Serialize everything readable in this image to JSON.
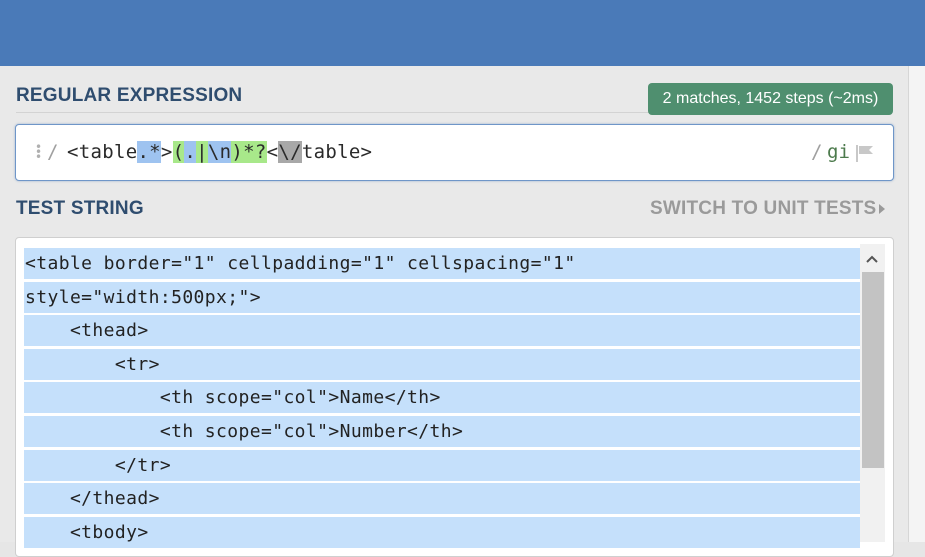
{
  "regex_section": {
    "label": "REGULAR EXPRESSION",
    "match_info": "2 matches, 1452 steps (~2ms)",
    "delimiter_open": "/",
    "delimiter_close": "/",
    "flags": "gi",
    "pattern_parts": [
      {
        "text": "<table",
        "highlight": "none"
      },
      {
        "text": ".*",
        "highlight": "blue"
      },
      {
        "text": ">",
        "highlight": "none"
      },
      {
        "text": "(",
        "highlight": "green"
      },
      {
        "text": ".",
        "highlight": "blue"
      },
      {
        "text": "|",
        "highlight": "green"
      },
      {
        "text": "\\n",
        "highlight": "blue"
      },
      {
        "text": ")*?",
        "highlight": "green"
      },
      {
        "text": "<",
        "highlight": "none"
      },
      {
        "text": "\\/",
        "highlight": "gray"
      },
      {
        "text": "table>",
        "highlight": "none"
      }
    ]
  },
  "test_section": {
    "label": "TEST STRING",
    "switch_label": "SWITCH TO UNIT TESTS",
    "lines": [
      "<table border=\"1\" cellpadding=\"1\" cellspacing=\"1\"",
      "style=\"width:500px;\">",
      "    <thead>",
      "        <tr>",
      "            <th scope=\"col\">Name</th>",
      "            <th scope=\"col\">Number</th>",
      "        </tr>",
      "    </thead>",
      "    <tbody>"
    ]
  },
  "colors": {
    "header": "#4a7ab8",
    "match_badge": "#4f8f6f",
    "match_highlight": "#c5e0fb",
    "token_blue": "#9ec3f0",
    "token_green": "#a8e88a",
    "token_gray": "#a8a8a8"
  }
}
